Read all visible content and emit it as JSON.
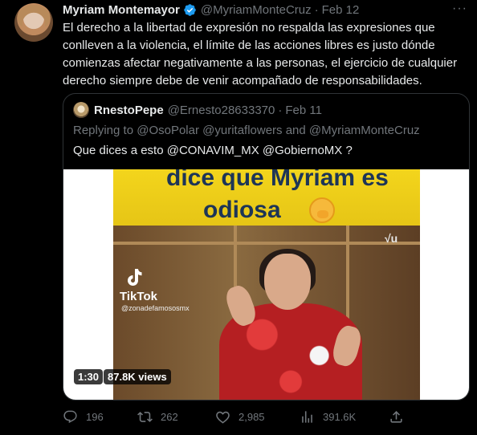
{
  "tweet": {
    "author_name": "Myriam Montemayor",
    "author_handle": "@MyriamMonteCruz",
    "separator": "·",
    "date": "Feb 12",
    "more_icon": "more-horizontal-icon",
    "text": "El derecho a la libertad de expresión no respalda las expresiones que conlleven a la violencia, el límite de las acciones libres es justo dónde comienzas afectar negativamente a las personas, el ejercicio de cualquier derecho siempre debe de venir acompañado de responsabilidades."
  },
  "quote": {
    "author_name": "RnestoPepe",
    "author_handle": "@Ernesto28633370",
    "separator": "·",
    "date": "Feb 11",
    "replying_to": "Replying to @OsoPolar @yuritaflowers and @MyriamMonteCruz",
    "text": "Que dices a esto @CONAVIM_MX @GobiernoMX ?",
    "video": {
      "banner_line1": "dice que Myriam es",
      "banner_line2": "odiosa",
      "logo": "√u",
      "tiktok_label": "TikTok",
      "tiktok_user": "@zonadefamososmx",
      "duration": "1:30",
      "views": "87.8K views"
    }
  },
  "actions": {
    "replies": "196",
    "retweets": "262",
    "likes": "2,985",
    "views": "391.6K"
  },
  "colors": {
    "background": "#000000",
    "text_primary": "#e7e9ea",
    "text_secondary": "#71767b",
    "verified": "#1d9bf0",
    "border": "#2f3336"
  }
}
